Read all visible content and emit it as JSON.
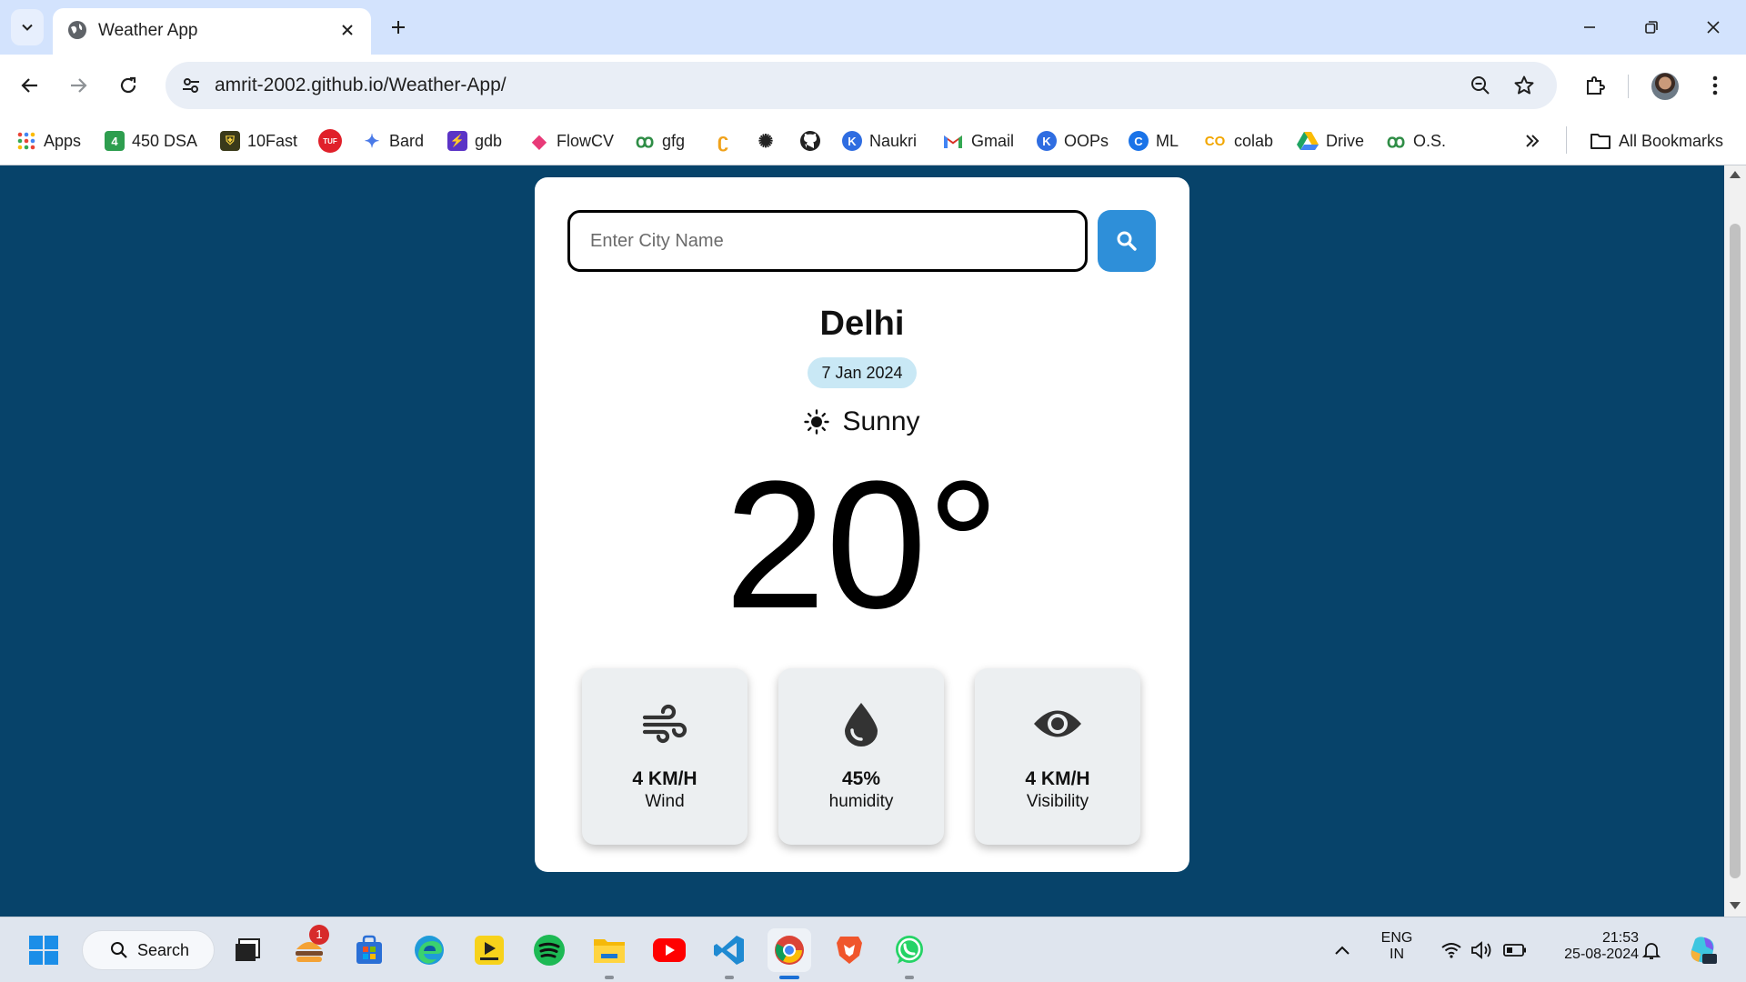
{
  "browser": {
    "tab_title": "Weather App",
    "url": "amrit-2002.github.io/Weather-App/",
    "bookmarks": [
      {
        "label": "Apps",
        "icon": "apps-grid-icon"
      },
      {
        "label": "450 DSA",
        "icon": "dsa-icon",
        "color": "#2e9e4f",
        "glyph": "4"
      },
      {
        "label": "10Fast",
        "icon": "tenfast-icon",
        "color": "#3a3a1a",
        "glyph": "⛨"
      },
      {
        "label": "",
        "icon": "tuf-icon",
        "color": "#e0202a",
        "glyph": "TUF"
      },
      {
        "label": "Bard",
        "icon": "bard-sparkle-icon",
        "color": "#4a7ae8",
        "glyph": "✦"
      },
      {
        "label": "gdb",
        "icon": "gdb-icon",
        "color": "#5b34c6",
        "glyph": "⚡"
      },
      {
        "label": "FlowCV",
        "icon": "flowcv-icon",
        "color": "#e83a78",
        "glyph": "◆"
      },
      {
        "label": "gfg",
        "icon": "gfg-icon",
        "color": "#2f8d46",
        "glyph": "ꝏ"
      },
      {
        "label": "",
        "icon": "leetcode-icon",
        "color": "#f0a21a",
        "glyph": "ʗ"
      },
      {
        "label": "",
        "icon": "chatgpt-icon",
        "color": "#222222",
        "glyph": "✺"
      },
      {
        "label": "",
        "icon": "github-icon",
        "color": "#222222",
        "glyph": "●"
      },
      {
        "label": "Naukri",
        "icon": "naukri-icon",
        "color": "#2f6de1",
        "glyph": "K"
      },
      {
        "label": "Gmail",
        "icon": "gmail-icon",
        "color": "#d93025",
        "glyph": "M"
      },
      {
        "label": "OOPs",
        "icon": "oops-icon",
        "color": "#2f6de1",
        "glyph": "K"
      },
      {
        "label": "ML",
        "icon": "ml-icon",
        "color": "#1a73e8",
        "glyph": "C"
      },
      {
        "label": "colab",
        "icon": "colab-icon",
        "color": "#f2a600",
        "glyph": "CO"
      },
      {
        "label": "Drive",
        "icon": "drive-icon",
        "color": "#1fa463",
        "glyph": "▲"
      },
      {
        "label": "O.S.",
        "icon": "gfg-icon",
        "color": "#2f8d46",
        "glyph": "ꝏ"
      }
    ],
    "all_bookmarks_label": "All Bookmarks"
  },
  "weather": {
    "search_placeholder": "Enter City Name",
    "city": "Delhi",
    "date": "7 Jan 2024",
    "condition": "Sunny",
    "temperature": "20°",
    "stats": [
      {
        "value": "4 KM/H",
        "label": "Wind",
        "icon": "wind-icon"
      },
      {
        "value": "45%",
        "label": "humidity",
        "icon": "droplet-icon"
      },
      {
        "value": "4 KM/H",
        "label": "Visibility",
        "icon": "eye-icon"
      }
    ]
  },
  "taskbar": {
    "search_label": "Search",
    "notification_badge": "1",
    "language": "ENG",
    "region": "IN",
    "time": "21:53",
    "date": "25-08-2024"
  },
  "colors": {
    "page_background": "#07436a",
    "search_button": "#2e8fd9",
    "date_pill": "#c9e8f5",
    "stat_card": "#eceff1"
  }
}
